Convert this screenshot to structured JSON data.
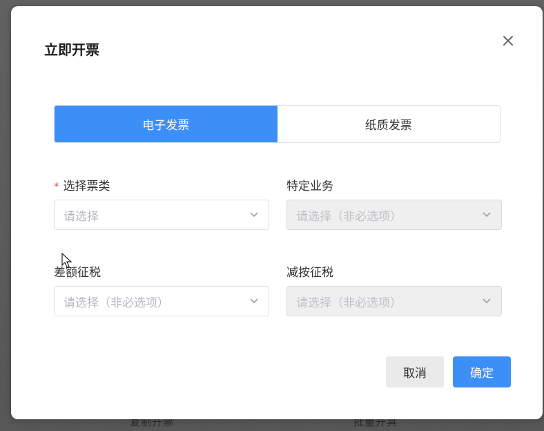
{
  "background": {
    "bottom_left_text": "复制开票",
    "bottom_right_text": "批量开具"
  },
  "modal": {
    "title": "立即开票",
    "close_icon": "close-icon",
    "tabs": [
      {
        "label": "电子发票",
        "active": true
      },
      {
        "label": "纸质发票",
        "active": false
      }
    ],
    "fields": {
      "invoice_type": {
        "required_mark": "*",
        "label": "选择票类",
        "placeholder": "请选择",
        "disabled": false
      },
      "special_business": {
        "label": "特定业务",
        "placeholder": "请选择（非必选项）",
        "disabled": true
      },
      "differential_tax": {
        "label": "差额征税",
        "placeholder": "请选择（非必选项）",
        "disabled": false
      },
      "reduced_tax": {
        "label": "减按征税",
        "placeholder": "请选择（非必选项）",
        "disabled": true
      }
    },
    "buttons": {
      "cancel": "取消",
      "confirm": "确定"
    }
  },
  "colors": {
    "primary": "#3d8ff8",
    "required": "#f05050",
    "disabled_bg": "#efefef"
  }
}
